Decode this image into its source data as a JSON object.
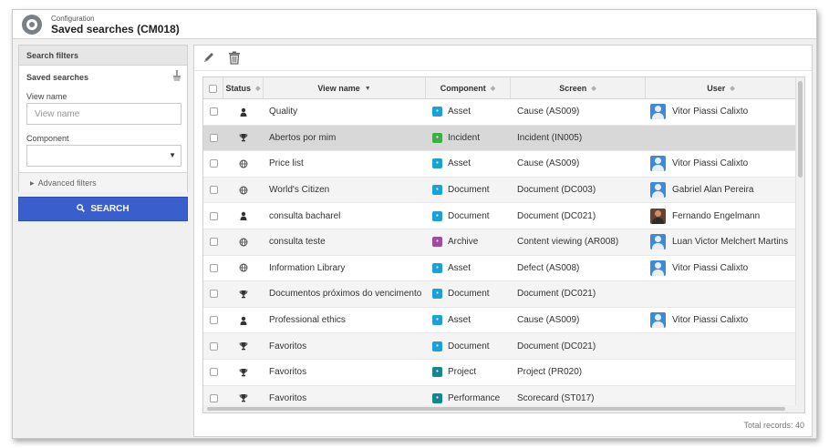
{
  "header": {
    "breadcrumb": "Configuration",
    "title": "Saved searches (CM018)"
  },
  "filters": {
    "panel_title": "Search filters",
    "saved_searches_label": "Saved searches",
    "view_name_label": "View name",
    "view_name_placeholder": "View name",
    "view_name_value": "",
    "component_label": "Component",
    "component_value": "",
    "advanced_label": "Advanced filters",
    "search_button": "SEARCH"
  },
  "toolbar": {
    "edit_icon": "pencil-icon",
    "delete_icon": "trash-icon"
  },
  "table": {
    "columns": {
      "status": "Status",
      "view_name": "View name",
      "component": "Component",
      "screen": "Screen",
      "user": "User"
    },
    "rows": [
      {
        "status_icon": "person-icon",
        "name": "Quality",
        "component": "Asset",
        "comp_color": "#1ba1d6",
        "screen": "Cause (AS009)",
        "user": "Vitor Piassi Calixto",
        "avatar": "blue"
      },
      {
        "status_icon": "trophy-icon",
        "name": "Abertos por mim",
        "component": "Incident",
        "comp_color": "#3fae49",
        "screen": "Incident (IN005)",
        "user": "",
        "avatar": ""
      },
      {
        "status_icon": "globe-icon",
        "name": "Price list",
        "component": "Asset",
        "comp_color": "#1ba1d6",
        "screen": "Cause (AS009)",
        "user": "Vitor Piassi Calixto",
        "avatar": "blue"
      },
      {
        "status_icon": "globe-icon",
        "name": "World's Citizen",
        "component": "Document",
        "comp_color": "#1ba1d6",
        "screen": "Document (DC003)",
        "user": "Gabriel Alan Pereira",
        "avatar": "blue"
      },
      {
        "status_icon": "person-icon",
        "name": "consulta bacharel",
        "component": "Document",
        "comp_color": "#1ba1d6",
        "screen": "Document (DC021)",
        "user": "Fernando Engelmann",
        "avatar": "photo"
      },
      {
        "status_icon": "globe-icon",
        "name": "consulta teste",
        "component": "Archive",
        "comp_color": "#a04c9c",
        "screen": "Content viewing (AR008)",
        "user": "Luan Victor Melchert Martins",
        "avatar": "blue"
      },
      {
        "status_icon": "globe-icon",
        "name": "Information Library",
        "component": "Asset",
        "comp_color": "#1ba1d6",
        "screen": "Defect (AS008)",
        "user": "Vitor Piassi Calixto",
        "avatar": "blue"
      },
      {
        "status_icon": "trophy-icon",
        "name": "Documentos próximos do vencimento",
        "component": "Document",
        "comp_color": "#1ba1d6",
        "screen": "Document (DC021)",
        "user": "",
        "avatar": ""
      },
      {
        "status_icon": "person-icon",
        "name": "Professional ethics",
        "component": "Asset",
        "comp_color": "#1ba1d6",
        "screen": "Cause (AS009)",
        "user": "Vitor Piassi Calixto",
        "avatar": "blue"
      },
      {
        "status_icon": "trophy-icon",
        "name": "Favoritos",
        "component": "Document",
        "comp_color": "#1ba1d6",
        "screen": "Document (DC021)",
        "user": "",
        "avatar": ""
      },
      {
        "status_icon": "trophy-icon",
        "name": "Favoritos",
        "component": "Project",
        "comp_color": "#12888c",
        "screen": "Project (PR020)",
        "user": "",
        "avatar": ""
      },
      {
        "status_icon": "trophy-icon",
        "name": "Favoritos",
        "component": "Performance",
        "comp_color": "#12888c",
        "screen": "Scorecard (ST017)",
        "user": "",
        "avatar": ""
      }
    ]
  },
  "footer": {
    "total": "Total records: 40"
  }
}
